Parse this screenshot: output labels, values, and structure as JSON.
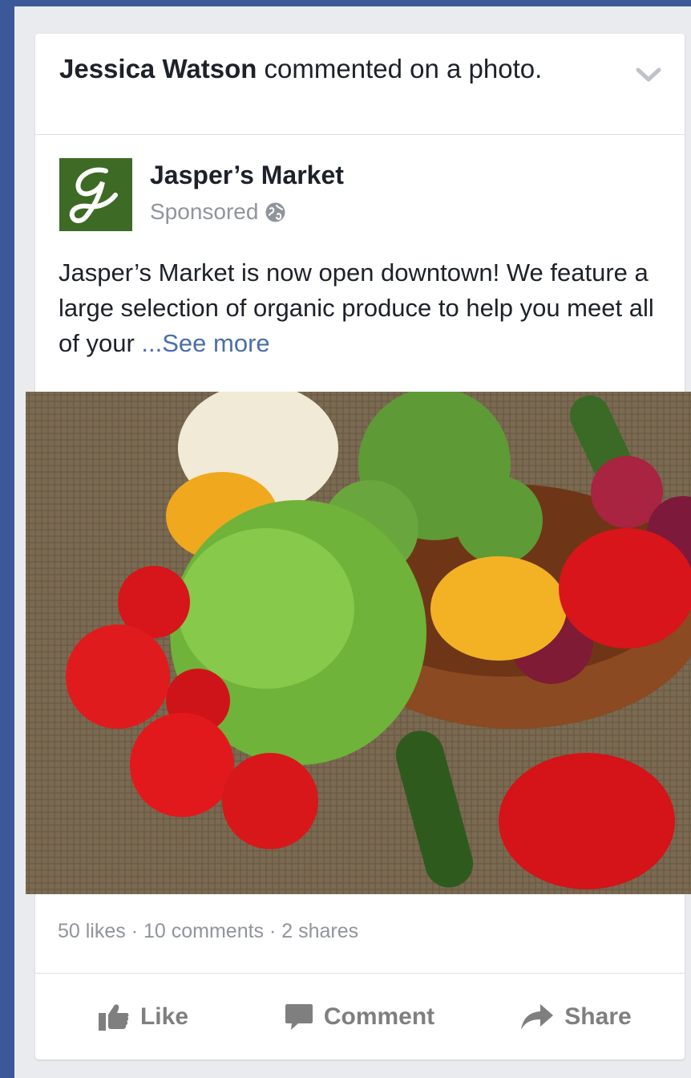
{
  "story": {
    "actor": "Jessica Watson",
    "action_text": " commented on a photo."
  },
  "post": {
    "page_name": "Jasper’s Market",
    "sponsored_label": "Sponsored",
    "body_text": "Jasper’s Market is now open downtown! We feature a large selection of organic produce to help you meet all of your ",
    "see_more": "...See more",
    "image_alt": "Vegetables: broccoli, tomatoes, lettuce, peppers, onions, cucumbers in a wooden bowl on burlap"
  },
  "stats": {
    "summary": "50 likes · 10 comments · 2 shares"
  },
  "actions": {
    "like": "Like",
    "comment": "Comment",
    "share": "Share"
  },
  "icons": {
    "chevron": "chevron-down-icon",
    "globe": "globe-icon",
    "like": "thumbs-up-icon",
    "comment": "speech-bubble-icon",
    "share": "share-arrow-icon"
  },
  "colors": {
    "brand_blue": "#3b5998",
    "link_blue": "#4b6ea9",
    "logo_green": "#3d6b26",
    "muted_text": "#90949c"
  }
}
